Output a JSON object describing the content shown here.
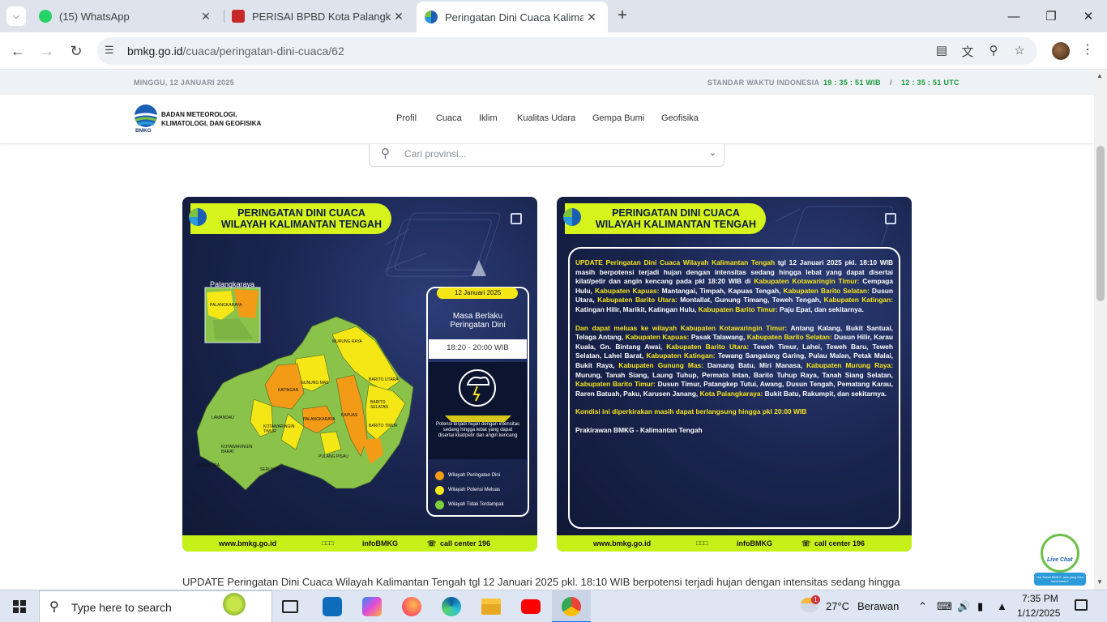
{
  "browser": {
    "tabs": [
      {
        "title": "(15) WhatsApp"
      },
      {
        "title": "PERISAI BPBD Kota Palangka Ra"
      },
      {
        "title": "Peringatan Dini Cuaca Kalimant"
      }
    ],
    "url_host": "bmkg.go.id",
    "url_path": "/cuaca/peringatan-dini-cuaca/62"
  },
  "site": {
    "date": "MINGGU, 12 JANUARI 2025",
    "time_label": "STANDAR WAKTU INDONESIA",
    "time_wib": "19 : 35 : 51 WIB",
    "time_sep": "/",
    "time_utc": "12 : 35 : 51 UTC",
    "logo_line1": "BADAN METEOROLOGI,",
    "logo_line2": "KLIMATOLOGI, DAN GEOFISIKA",
    "logo_small": "BMKG",
    "nav": [
      "Profil",
      "Cuaca",
      "Iklim",
      "Kualitas Udara",
      "Gempa Bumi",
      "Geofisika"
    ],
    "search_placeholder": "Cari provinsi..."
  },
  "card1": {
    "title1": "PERINGATAN DINI CUACA",
    "title2": "WILAYAH KALIMANTAN TENGAH",
    "inset_label": "Palangkaraya",
    "inset_sub": "PALANGKARAYA",
    "regions": [
      "MURUNG RAYA",
      "GUNUNG MAS",
      "KATINGAN",
      "BARITO UTARA",
      "BARITO SELATAN",
      "KAPUAS",
      "BARITO TIMUR",
      "LAMANDAU",
      "KOTAWARINGIN TIMUR",
      "PALANGKARAYA",
      "KOTAWARINGIN BARAT",
      "SUKAMARA",
      "SERUYAN",
      "PULANG PISAU"
    ],
    "date": "12 Januari 2025",
    "masa1": "Masa Berlaku",
    "masa2": "Peringatan Dini",
    "time": "18:20 - 20:00 WIB",
    "desc": "Potensi terjadi hujan dengan intensitas sedang hingga lebat yang dapat disertai kilat/petir dan angin kencang",
    "legend": [
      "Wilayah Peringatan Dini",
      "Wilayah Potensi Meluas",
      "Wilayah Tidak Terdampak"
    ],
    "legend_colors": [
      "#f39a16",
      "#f5e716",
      "#7fd13b"
    ]
  },
  "footer": {
    "web": "www.bmkg.go.id",
    "social": "infoBMKG",
    "call": "call center 196"
  },
  "card2": {
    "title1": "PERINGATAN DINI CUACA",
    "title2": "WILAYAH KALIMANTAN TENGAH",
    "p1_intro": "UPDATE Peringatan Dini Cuaca Wilayah Kalimantan Tengah",
    "p1a": " tgl 12 Januari 2025 pkl. 18:10 WIB masih berpotensi terjadi hujan dengan intensitas sedang hingga lebat yang dapat disertai kilat/petir dan angin kencang pada pkl 18:20 WIB di ",
    "k1": "Kabupaten Kotawaringin Timur:",
    "v1": " Cempaga Hulu, ",
    "k2": "Kabupaten Kapuas:",
    "v2": " Mantangai, Timpah, Kapuas Tengah, ",
    "k3": "Kabupaten Barito Selatan:",
    "v3": " Dusun Utara, ",
    "k4": "Kabupaten Barito Utara:",
    "v4": " Montallat, Gunung Timang, Teweh Tengah, ",
    "k5": "Kabupaten Katingan:",
    "v5": " Katingan Hilir, Marikit, Katingan Hulu, ",
    "k6": "Kabupaten Barito Timur:",
    "v6": " Paju Epat, dan sekitarnya.",
    "p2_intro": "Dan dapat meluas ke wilayah",
    "m1": " Kabupaten Kotawaringin Timur:",
    "w1": " Antang Kalang, Bukit Santuai, Telaga Antang, ",
    "m2": "Kabupaten Kapuas:",
    "w2": " Pasak Talawang, ",
    "m3": "Kabupaten Barito Selatan:",
    "w3": " Dusun Hilir, Karau Kuala, Gn. Bintang Awai, ",
    "m4": "Kabupaten Barito Utara:",
    "w4": " Teweh Timur, Lahei, Teweh Baru, Teweh Selatan, Lahei Barat, ",
    "m5": "Kabupaten Katingan:",
    "w5": " Tewang Sangalang Garing, Pulau Malan, Petak Malai, Bukit Raya, ",
    "m6": "Kabupaten Gunung Mas:",
    "w6": " Damang Batu, Miri Manasa, ",
    "m7": "Kabupaten Murung Raya:",
    "w7": " Murung, Tanah Siang, Laung Tuhup, Permata Intan, Barito Tuhup Raya, Tanah Siang Selatan, ",
    "m8": "Kabupaten Barito Timur:",
    "w8": " Dusun Timur, Patangkep Tutui, Awang, Dusun Tengah, Pematang Karau, Raren Batuah, Paku, Karusen Janang, ",
    "m9": "Kota Palangkaraya:",
    "w9": " Bukit Batu, Rakumpit, dan sekitarnya.",
    "p3": "Kondisi ini diperkirakan masih dapat berlangsung hingga pkl 20:00 WIB",
    "p4": "Prakirawan BMKG - Kalimantan Tengah"
  },
  "article": "UPDATE Peringatan Dini Cuaca Wilayah Kalimantan Tengah tgl 12 Januari 2025 pkl. 18:10 WIB berpotensi terjadi hujan dengan intensitas sedang hingga",
  "livechat": {
    "title": "Live Chat",
    "sub": "Hai Sobat BMKG, ada yang bisa kami bantu?"
  },
  "taskbar": {
    "search_placeholder": "Type here to search",
    "weather_temp": "27°C",
    "weather_desc": "Berawan",
    "weather_badge": "1",
    "time": "7:35 PM",
    "date": "1/12/2025"
  }
}
